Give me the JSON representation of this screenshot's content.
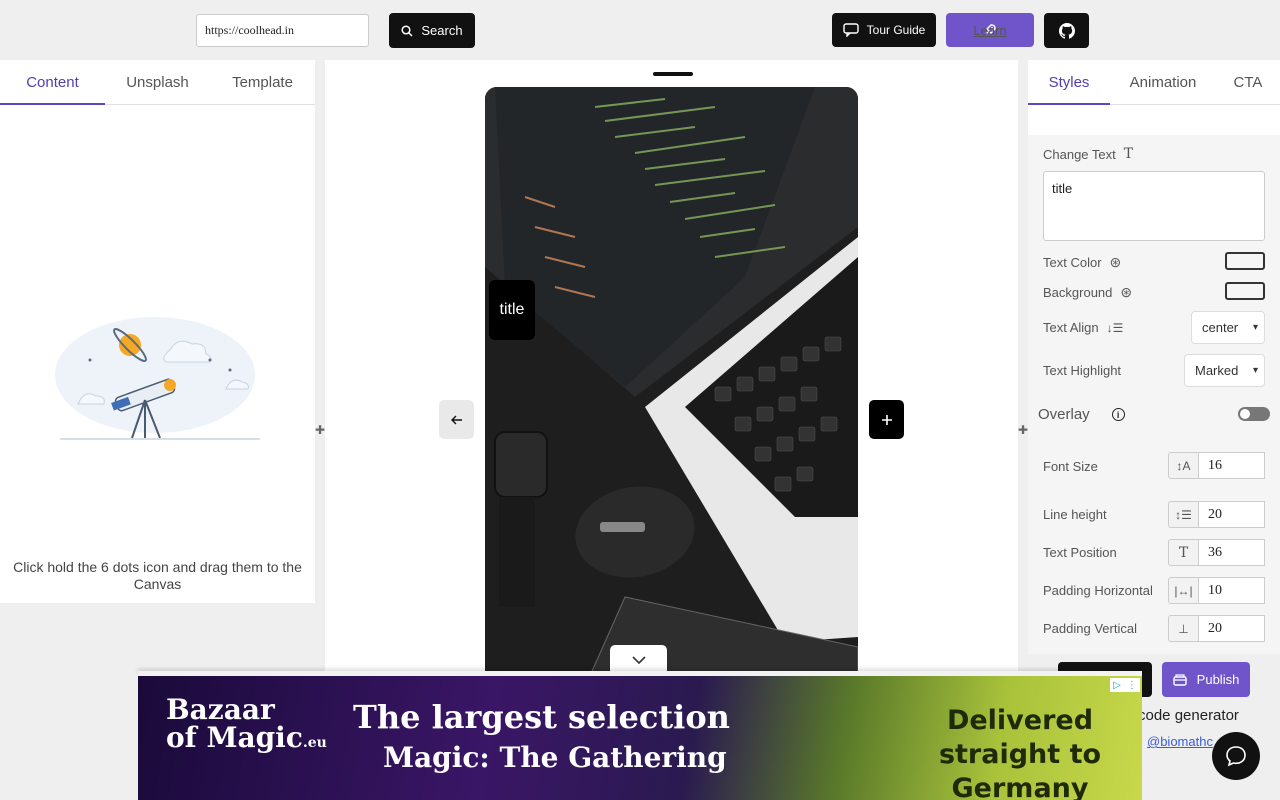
{
  "topbar": {
    "url_value": "https://coolhead.in",
    "search_label": "Search",
    "tour_label": "Tour Guide",
    "learn_label": "Learn"
  },
  "left_panel": {
    "tabs": [
      {
        "label": "Content",
        "active": true
      },
      {
        "label": "Unsplash",
        "active": false
      },
      {
        "label": "Template",
        "active": false
      }
    ],
    "hint": "Click hold the 6 dots icon and drag them to the Canvas"
  },
  "canvas": {
    "title_text": "title"
  },
  "right_panel": {
    "tabs": [
      {
        "label": "Styles",
        "active": true
      },
      {
        "label": "Animation",
        "active": false
      },
      {
        "label": "CTA",
        "active": false
      }
    ],
    "change_text_label": "Change Text",
    "text_value": "title",
    "text_color_label": "Text Color",
    "background_label": "Background",
    "text_align_label": "Text Align",
    "text_align_value": "center",
    "text_highlight_label": "Text Highlight",
    "text_highlight_value": "Marked",
    "overlay_label": "Overlay",
    "overlay_on": false,
    "font_size_label": "Font Size",
    "font_size_value": "16",
    "line_height_label": "Line height",
    "line_height_value": "20",
    "text_position_label": "Text Position",
    "text_position_value": "36",
    "padding_h_label": "Padding Horizontal",
    "padding_h_value": "10",
    "padding_v_label": "Padding Vertical",
    "padding_v_value": "20"
  },
  "footer": {
    "publish_label": "Publish",
    "code_generator_text": "code generator",
    "handle_text": "@biomathc"
  },
  "ad": {
    "brand_line1": "Bazaar",
    "brand_line2": "of Magic",
    "brand_suffix": ".eu",
    "headline": "The largest selection",
    "subline": "Magic: The Gathering",
    "right_text": "Delivered straight to Germany"
  },
  "colors": {
    "accent": "#6f55c9",
    "dark": "#111111",
    "tab_active": "#4f3fb3"
  }
}
